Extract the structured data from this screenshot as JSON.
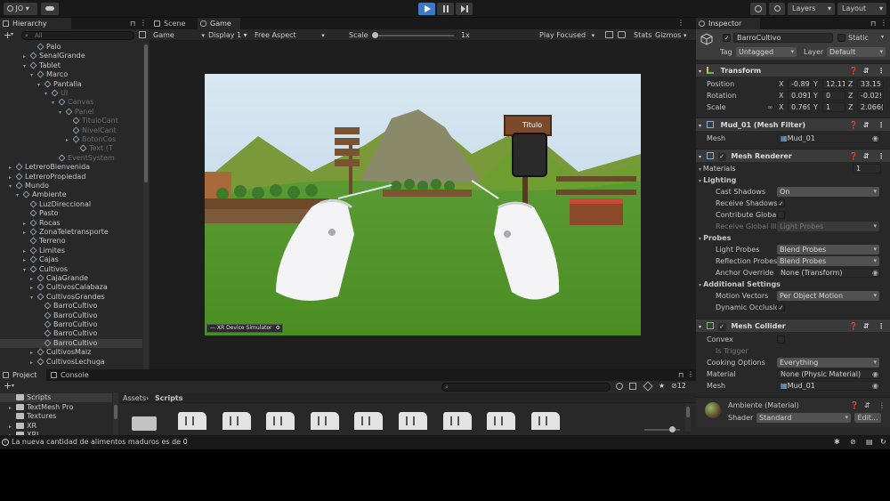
{
  "toolbar": {
    "account": "JO",
    "layers": "Layers",
    "layout": "Layout"
  },
  "hierarchy": {
    "tab": "Hierarchy",
    "search_placeholder": "All",
    "rows": [
      {
        "label": "Palo",
        "indent": 5,
        "arrow": "",
        "state": ""
      },
      {
        "label": "SenalGrande",
        "indent": 4,
        "arrow": "▸",
        "state": ""
      },
      {
        "label": "Tablet",
        "indent": 4,
        "arrow": "▾",
        "state": ""
      },
      {
        "label": "Marco",
        "indent": 5,
        "arrow": "▾",
        "state": ""
      },
      {
        "label": "Pantalla",
        "indent": 6,
        "arrow": "▾",
        "state": ""
      },
      {
        "label": "UI",
        "indent": 7,
        "arrow": "▾",
        "state": "dim"
      },
      {
        "label": "Canvas",
        "indent": 8,
        "arrow": "▾",
        "state": "dim"
      },
      {
        "label": "Panel",
        "indent": 9,
        "arrow": "▾",
        "state": "dim"
      },
      {
        "label": "TituloCant",
        "indent": 10,
        "arrow": "",
        "state": "dim"
      },
      {
        "label": "NivelCant",
        "indent": 10,
        "arrow": "",
        "state": "dim"
      },
      {
        "label": "BotonCos",
        "indent": 10,
        "arrow": "▸",
        "state": "dim"
      },
      {
        "label": "Text (T",
        "indent": 11,
        "arrow": "",
        "state": "dim"
      },
      {
        "label": "EventSystem",
        "indent": 8,
        "arrow": "",
        "state": "dim"
      },
      {
        "label": "LetreroBienvenida",
        "indent": 2,
        "arrow": "▸",
        "state": ""
      },
      {
        "label": "LetreroPropiedad",
        "indent": 2,
        "arrow": "▸",
        "state": ""
      },
      {
        "label": "Mundo",
        "indent": 2,
        "arrow": "▾",
        "state": ""
      },
      {
        "label": "Ambiente",
        "indent": 3,
        "arrow": "▾",
        "state": ""
      },
      {
        "label": "LuzDireccional",
        "indent": 4,
        "arrow": "",
        "state": ""
      },
      {
        "label": "Pasto",
        "indent": 4,
        "arrow": "",
        "state": ""
      },
      {
        "label": "Rocas",
        "indent": 4,
        "arrow": "▸",
        "state": ""
      },
      {
        "label": "ZonaTeletransporte",
        "indent": 4,
        "arrow": "▸",
        "state": ""
      },
      {
        "label": "Terreno",
        "indent": 4,
        "arrow": "",
        "state": ""
      },
      {
        "label": "Limites",
        "indent": 4,
        "arrow": "▸",
        "state": ""
      },
      {
        "label": "Cajas",
        "indent": 4,
        "arrow": "▸",
        "state": ""
      },
      {
        "label": "Cultivos",
        "indent": 4,
        "arrow": "▾",
        "state": ""
      },
      {
        "label": "CajaGrande",
        "indent": 5,
        "arrow": "▸",
        "state": ""
      },
      {
        "label": "CultivosCalabaza",
        "indent": 5,
        "arrow": "▸",
        "state": ""
      },
      {
        "label": "CultivosGrandes",
        "indent": 5,
        "arrow": "▾",
        "state": ""
      },
      {
        "label": "BarroCultivo",
        "indent": 6,
        "arrow": "",
        "state": ""
      },
      {
        "label": "BarroCultivo",
        "indent": 6,
        "arrow": "",
        "state": ""
      },
      {
        "label": "BarroCultivo",
        "indent": 6,
        "arrow": "",
        "state": ""
      },
      {
        "label": "BarroCultivo",
        "indent": 6,
        "arrow": "",
        "state": ""
      },
      {
        "label": "BarroCultivo",
        "indent": 6,
        "arrow": "",
        "state": "hl"
      },
      {
        "label": "CultivosMaiz",
        "indent": 5,
        "arrow": "▸",
        "state": ""
      },
      {
        "label": "CultivosLechuga",
        "indent": 5,
        "arrow": "▸",
        "state": ""
      }
    ]
  },
  "scene_tabs": {
    "scene": "Scene",
    "game": "Game"
  },
  "game_bar": {
    "display_mode": "Game",
    "display": "Display 1",
    "aspect": "Free Aspect",
    "scale_label": "Scale",
    "scale_value": "1x",
    "play_focused": "Play Focused",
    "stats": "Stats",
    "gizmos": "Gizmos"
  },
  "game_view": {
    "sign_text": "Titulo",
    "simulator_label": "XR Device Simulator"
  },
  "bottom": {
    "project_tab": "Project",
    "console_tab": "Console",
    "breadcrumb_root": "Assets",
    "breadcrumb_current": "Scripts",
    "folders": [
      {
        "label": "Scripts",
        "arrow": "",
        "selected": true
      },
      {
        "label": "TextMesh Pro",
        "arrow": "▸",
        "selected": false
      },
      {
        "label": "Textures",
        "arrow": "",
        "selected": false
      },
      {
        "label": "XR",
        "arrow": "▸",
        "selected": false
      },
      {
        "label": "XRI",
        "arrow": "▸",
        "selected": false
      }
    ],
    "hidden_count": "12",
    "file_count": 9
  },
  "status": {
    "message": "La nueva cantidad de alimentos maduros es de 0"
  },
  "inspector": {
    "tab": "Inspector",
    "object_name": "BarroCultivo",
    "static_label": "Static",
    "tag_label": "Tag",
    "tag_value": "Untagged",
    "layer_label": "Layer",
    "layer_value": "Default",
    "transform": {
      "title": "Transform",
      "position_label": "Position",
      "rotation_label": "Rotation",
      "scale_label": "Scale",
      "position": {
        "x": "-0.89(",
        "y": "12.111",
        "z": "33.15"
      },
      "rotation": {
        "x": "0.091",
        "y": "0",
        "z": "-0.02!"
      },
      "scale": {
        "x": "0.769",
        "y": "1",
        "z": "2.066("
      }
    },
    "mesh_filter": {
      "title": "Mud_01 (Mesh Filter)",
      "mesh_label": "Mesh",
      "mesh_value": "Mud_01"
    },
    "mesh_renderer": {
      "title": "Mesh Renderer",
      "materials_label": "Materials",
      "materials_count": "1",
      "lighting_label": "Lighting",
      "cast_shadows_label": "Cast Shadows",
      "cast_shadows_value": "On",
      "receive_shadows_label": "Receive Shadows",
      "contribute_gi_label": "Contribute Global",
      "receive_gi_label": "Receive Global Ill",
      "receive_gi_value": "Light Probes",
      "probes_label": "Probes",
      "light_probes_label": "Light Probes",
      "light_probes_value": "Blend Probes",
      "reflection_probes_label": "Reflection Probes",
      "reflection_probes_value": "Blend Probes",
      "anchor_label": "Anchor Override",
      "anchor_value": "None (Transform)",
      "additional_label": "Additional Settings",
      "motion_vectors_label": "Motion Vectors",
      "motion_vectors_value": "Per Object Motion",
      "dynamic_occlusion_label": "Dynamic Occlusio"
    },
    "mesh_collider": {
      "title": "Mesh Collider",
      "convex_label": "Convex",
      "is_trigger_label": "Is Trigger",
      "cooking_label": "Cooking Options",
      "cooking_value": "Everything",
      "material_label": "Material",
      "material_value": "None (Physic Material)",
      "mesh_label": "Mesh",
      "mesh_value": "Mud_01"
    },
    "material": {
      "name": "Ambiente (Material)",
      "shader_label": "Shader",
      "shader_value": "Standard",
      "edit_label": "Edit..."
    }
  },
  "colors": {
    "accent": "#2c5d87",
    "play_active": "#3e7ac4"
  }
}
